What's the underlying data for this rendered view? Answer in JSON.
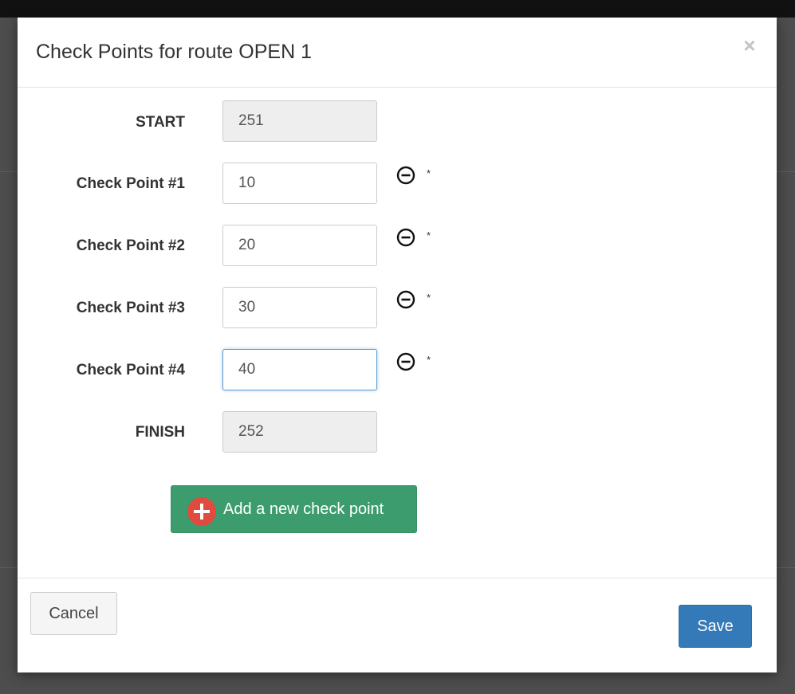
{
  "modal": {
    "title": "Check Points for route OPEN 1",
    "close_symbol": "×"
  },
  "rows": [
    {
      "label": "START",
      "value": "251",
      "readonly": true
    },
    {
      "label": "Check Point #1",
      "value": "10",
      "readonly": false,
      "remove_icon": "minus-circle-icon",
      "marker": "*"
    },
    {
      "label": "Check Point #2",
      "value": "20",
      "readonly": false,
      "remove_icon": "minus-circle-icon",
      "marker": "*"
    },
    {
      "label": "Check Point #3",
      "value": "30",
      "readonly": false,
      "remove_icon": "minus-circle-icon",
      "marker": "*"
    },
    {
      "label": "Check Point #4",
      "value": "40",
      "readonly": false,
      "remove_icon": "minus-circle-icon",
      "marker": "*",
      "focused": true
    },
    {
      "label": "FINISH",
      "value": "252",
      "readonly": true
    }
  ],
  "add_button": {
    "label": "Add a new check point",
    "icon": "plus-circle-icon"
  },
  "footer": {
    "cancel_label": "Cancel",
    "save_label": "Save"
  },
  "colors": {
    "add_button_bg": "#3c9c6e",
    "add_icon_bg": "#e04a3f",
    "save_button_bg": "#3479b8",
    "readonly_field_bg": "#eeeeee",
    "focus_border": "#5b9bd5"
  }
}
